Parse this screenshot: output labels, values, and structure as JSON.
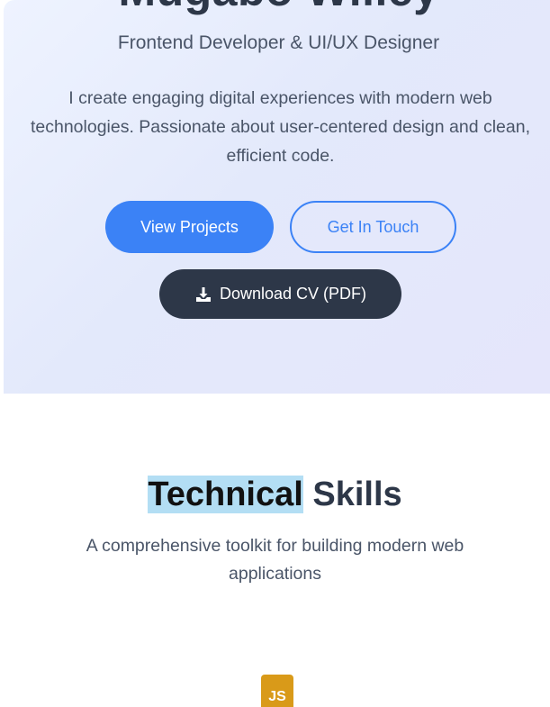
{
  "hero": {
    "name": "Mugabo Willey",
    "role": "Frontend Developer & UI/UX Designer",
    "description": "I create engaging digital experiences with modern web technologies. Passionate about user-centered design and clean, efficient code.",
    "buttons": {
      "view_projects": "View Projects",
      "get_in_touch": "Get In Touch",
      "download_cv": "Download CV (PDF)"
    }
  },
  "skills": {
    "title_highlight": "Technical",
    "title_rest": " Skills",
    "subtitle": "A comprehensive toolkit for building modern web applications",
    "first_badge": "JS"
  },
  "colors": {
    "primary": "#3b82f6",
    "dark": "#2d3748",
    "js_badge": "#d99a19",
    "highlight": "#b3def4"
  },
  "icons": {
    "download": "download-icon"
  }
}
